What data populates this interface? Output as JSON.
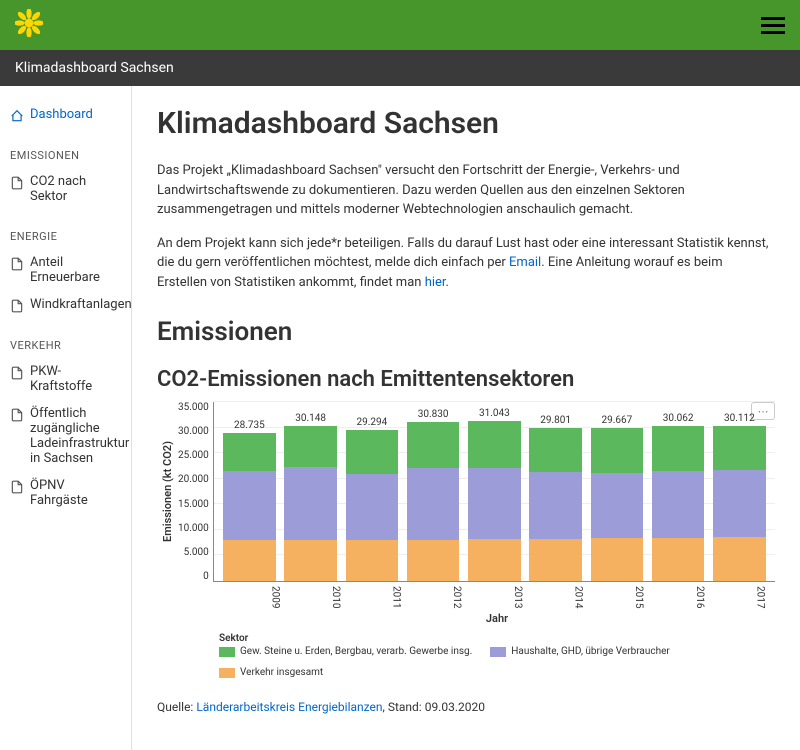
{
  "topbar": {
    "logo_alt": "Sunflower logo"
  },
  "breadcrumb": {
    "title": "Klimadashboard Sachsen"
  },
  "sidebar": {
    "dashboard": "Dashboard",
    "sections": [
      {
        "title": "EMISSIONEN",
        "items": [
          {
            "label": "CO2 nach Sektor"
          }
        ]
      },
      {
        "title": "ENERGIE",
        "items": [
          {
            "label": "Anteil Erneuerbare"
          },
          {
            "label": "Windkraftanlagen"
          }
        ]
      },
      {
        "title": "VERKEHR",
        "items": [
          {
            "label": "PKW-Kraftstoffe"
          },
          {
            "label": "Öffentlich zugängliche Ladeinfrastruktur in Sachsen"
          },
          {
            "label": "ÖPNV Fahrgäste"
          }
        ]
      }
    ]
  },
  "main": {
    "h1": "Klimadashboard Sachsen",
    "p1": "Das Projekt „Klimadashboard Sachsen\" versucht den Fortschritt der Energie-, Verkehrs- und Landwirtschaftswende zu dokumentieren. Dazu werden Quellen aus den einzelnen Sektoren zusammengetragen und mittels moderner Webtechnologien anschaulich gemacht.",
    "p2_pre": "An dem Projekt kann sich jede*r beteiligen. Falls du darauf Lust hast oder eine interessant Statistik kennst, die du gern veröffentlichen möchtest, melde dich einfach per ",
    "p2_link1": "Email",
    "p2_mid": ". Eine Anleitung worauf es beim Erstellen von Statistiken ankommt, findet man ",
    "p2_link2": "hier",
    "p2_post": ".",
    "h2": "Emissionen",
    "h3": "CO2-Emissionen nach Emittentensektoren",
    "source_prefix": "Quelle: ",
    "source_link": "Länderarbeitskreis Energiebilanzen",
    "source_suffix": ", Stand: 09.03.2020"
  },
  "chart_data": {
    "type": "bar",
    "stacked": true,
    "categories": [
      "2009",
      "2010",
      "2011",
      "2012",
      "2013",
      "2014",
      "2015",
      "2016",
      "2017"
    ],
    "series": [
      {
        "name": "Verkehr insgesamt",
        "color": "#f5b060",
        "values": [
          8000,
          8000,
          7900,
          8000,
          8100,
          8200,
          8300,
          8400,
          8500
        ]
      },
      {
        "name": "Haushalte, GHD, übrige Verbraucher",
        "color": "#9c9cd8",
        "values": [
          13300,
          14200,
          12900,
          14000,
          13900,
          13000,
          12800,
          13000,
          13000
        ]
      },
      {
        "name": "Gew. Steine u. Erden, Bergbau, verarb. Gewerbe insg.",
        "color": "#5cb85c",
        "values": [
          7435,
          7948,
          8494,
          8830,
          9043,
          8601,
          8567,
          8662,
          8612
        ]
      }
    ],
    "totals": [
      28735,
      30148,
      29294,
      30830,
      31043,
      29801,
      29667,
      30062,
      30112
    ],
    "total_labels": [
      "28.735",
      "30.148",
      "29.294",
      "30.830",
      "31.043",
      "29.801",
      "29.667",
      "30.062",
      "30.112"
    ],
    "ylabel": "Emissionen (kt CO2)",
    "xlabel": "Jahr",
    "legend_title": "Sektor",
    "ylim": [
      0,
      35000
    ],
    "y_ticks": [
      "35.000",
      "30.000",
      "25.000",
      "20.000",
      "15.000",
      "10.000",
      "5.000",
      "0"
    ]
  }
}
